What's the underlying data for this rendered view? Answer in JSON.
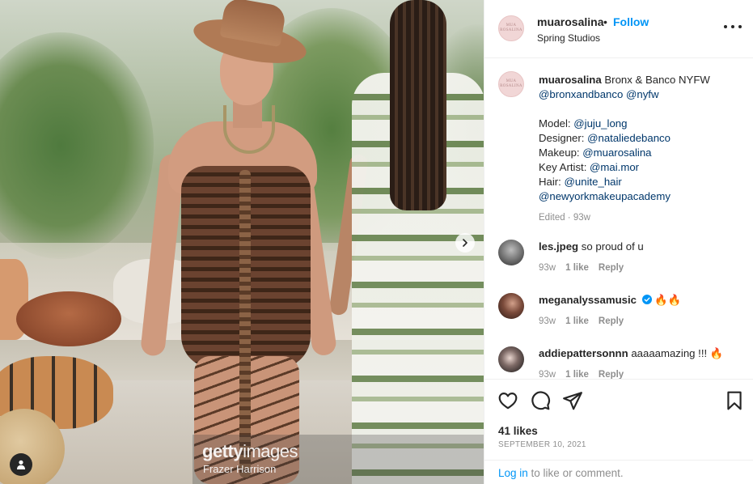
{
  "post": {
    "photo": {
      "watermark_brand_bold": "getty",
      "watermark_brand_light": "images",
      "photographer_credit": "Frazer Harrison"
    },
    "header": {
      "avatar_text": "MUA ROSALINA",
      "username": "muarosalina",
      "separator": "•",
      "follow_label": "Follow",
      "location": "Spring Studios"
    },
    "caption": {
      "avatar_text": "MUA ROSALINA",
      "username": "muarosalina",
      "title": "Bronx & Banco NYFW",
      "tag_1": "@bronxandbanco",
      "tag_2": "@nyfw",
      "model_label": "Model:",
      "model_handle": "@juju_long",
      "designer_label": "Designer:",
      "designer_handle": "@nataliedebanco",
      "makeup_label": "Makeup:",
      "makeup_handle": "@muarosalina",
      "keyartist_label": "Key Artist:",
      "keyartist_handle": "@mai.mor",
      "hair_label": "Hair:",
      "hair_handle": "@unite_hair",
      "academy_handle": "@newyorkmakeupacademy",
      "meta": "Edited · 93w"
    },
    "comments": [
      {
        "username": "les.jpeg",
        "text": "so proud of u",
        "age": "93w",
        "likes": "1 like",
        "reply": "Reply"
      },
      {
        "username": "meganalyssamusic",
        "text": "🔥🔥",
        "age": "93w",
        "likes": "1 like",
        "reply": "Reply",
        "verified": true
      },
      {
        "username": "addiepattersonnn",
        "text": "aaaaamazing !!! 🔥",
        "age": "93w",
        "likes": "1 like",
        "reply": "Reply"
      }
    ],
    "likes": "41 likes",
    "date": "SEPTEMBER 10, 2021",
    "login": {
      "link": "Log in",
      "rest": " to like or comment."
    },
    "icons": {
      "like": "heart-icon",
      "comment": "comment-icon",
      "share": "paper-plane-icon",
      "save": "bookmark-icon",
      "more": "more-icon",
      "next": "chevron-right-icon",
      "tag": "user-tag-icon"
    },
    "colors": {
      "link": "#00376b",
      "follow": "#0095f6",
      "muted": "#8e8e8e",
      "verified": "#0095f6"
    }
  }
}
